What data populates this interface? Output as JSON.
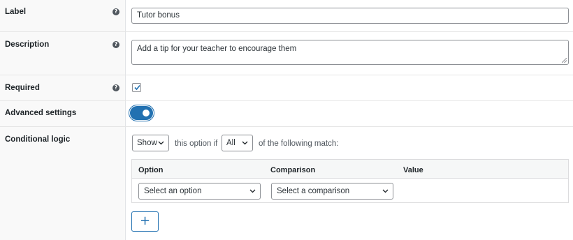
{
  "fields": {
    "label": {
      "title": "Label",
      "value": "Tutor bonus"
    },
    "description": {
      "title": "Description",
      "value": "Add a tip for your teacher to encourage them"
    },
    "required": {
      "title": "Required",
      "checked": true
    },
    "advanced": {
      "title": "Advanced settings",
      "enabled": true
    },
    "conditional": {
      "title": "Conditional logic",
      "action": "Show",
      "middle_text": "this option if",
      "match": "All",
      "tail_text": "of the following match:"
    }
  },
  "rules_table": {
    "headers": [
      "Option",
      "Comparison",
      "Value"
    ],
    "rows": [
      {
        "option": "Select an option",
        "comparison": "Select a comparison",
        "value": ""
      }
    ]
  },
  "add_button": {
    "label": "+"
  },
  "help_glyph": "?",
  "colors": {
    "accent": "#2271b1",
    "border": "#8c8f94",
    "label_bg": "#f9f9f9"
  },
  "icons": [
    "help-icon",
    "checkmark-icon",
    "chevron-down-icon",
    "plus-icon"
  ]
}
